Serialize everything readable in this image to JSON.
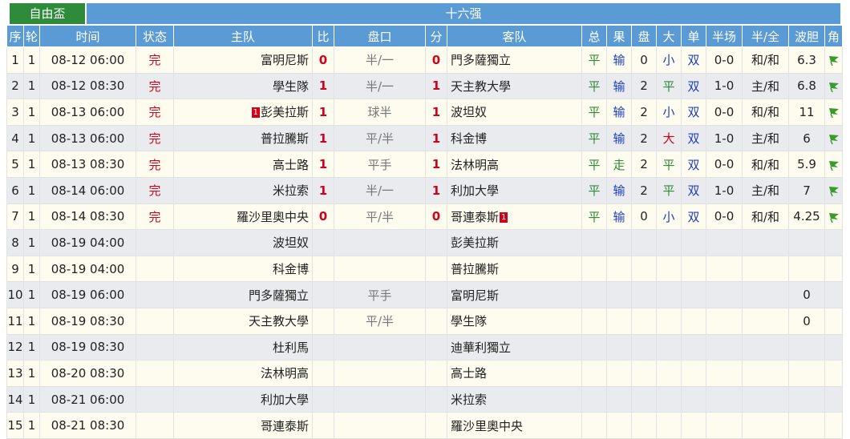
{
  "tabs": {
    "cup": "自由盃",
    "round": "十六强"
  },
  "headers": [
    "序",
    "轮",
    "时间",
    "状态",
    "主队",
    "比",
    "盘口",
    "分",
    "客队",
    "总",
    "果",
    "盘",
    "大",
    "单",
    "半场",
    "半/全",
    "波胆",
    "角"
  ],
  "rows": [
    {
      "no": "1",
      "rd": "1",
      "time": "08-12 06:00",
      "status": "完",
      "home": "富明尼斯",
      "hs": "0",
      "line": "半/一",
      "as": "0",
      "away": "門多薩獨立",
      "total": "平",
      "result": "输",
      "pan": "0",
      "size": "小",
      "oe": "双",
      "half": "0-0",
      "hf": "和/和",
      "odds": "6.3",
      "corner": "flag"
    },
    {
      "no": "2",
      "rd": "1",
      "time": "08-12 08:30",
      "status": "完",
      "home": "學生隊",
      "hs": "1",
      "line": "半/一",
      "as": "1",
      "away": "天主教大學",
      "total": "平",
      "result": "输",
      "pan": "2",
      "size": "平",
      "oe": "双",
      "half": "1-0",
      "hf": "主/和",
      "odds": "6.8",
      "corner": "flag"
    },
    {
      "no": "3",
      "rd": "1",
      "time": "08-13 06:00",
      "status": "完",
      "home": "彭美拉斯",
      "homecard": "1",
      "hs": "1",
      "line": "球半",
      "as": "1",
      "away": "波坦奴",
      "total": "平",
      "result": "输",
      "pan": "2",
      "size": "小",
      "oe": "双",
      "half": "0-0",
      "hf": "和/和",
      "odds": "11",
      "corner": "flag"
    },
    {
      "no": "4",
      "rd": "1",
      "time": "08-13 06:00",
      "status": "完",
      "home": "普拉騰斯",
      "hs": "1",
      "line": "平/半",
      "as": "1",
      "away": "科金博",
      "total": "平",
      "result": "输",
      "pan": "2",
      "size": "大",
      "oe": "双",
      "half": "1-0",
      "hf": "主/和",
      "odds": "6",
      "corner": "flag"
    },
    {
      "no": "5",
      "rd": "1",
      "time": "08-13 08:30",
      "status": "完",
      "home": "高士路",
      "hs": "1",
      "line": "平手",
      "as": "1",
      "away": "法林明高",
      "total": "平",
      "result": "走",
      "pan": "2",
      "size": "平",
      "oe": "双",
      "half": "0-0",
      "hf": "和/和",
      "odds": "5.9",
      "corner": "flag"
    },
    {
      "no": "6",
      "rd": "1",
      "time": "08-14 06:00",
      "status": "完",
      "home": "米拉索",
      "hs": "1",
      "line": "半/一",
      "as": "1",
      "away": "利加大學",
      "total": "平",
      "result": "输",
      "pan": "2",
      "size": "平",
      "oe": "双",
      "half": "1-0",
      "hf": "主/和",
      "odds": "7",
      "corner": "flag"
    },
    {
      "no": "7",
      "rd": "1",
      "time": "08-14 08:30",
      "status": "完",
      "home": "羅沙里奧中央",
      "hs": "0",
      "line": "平/半",
      "as": "0",
      "away": "哥連泰斯",
      "awaycard": "1",
      "total": "平",
      "result": "输",
      "pan": "0",
      "size": "小",
      "oe": "双",
      "half": "0-0",
      "hf": "和/和",
      "odds": "4.25",
      "corner": "flag"
    },
    {
      "no": "8",
      "rd": "1",
      "time": "08-19 04:00",
      "status": "",
      "home": "波坦奴",
      "hs": "",
      "line": "",
      "as": "",
      "away": "彭美拉斯",
      "total": "",
      "result": "",
      "pan": "",
      "size": "",
      "oe": "",
      "half": "",
      "hf": "",
      "odds": "",
      "corner": ""
    },
    {
      "no": "9",
      "rd": "1",
      "time": "08-19 04:00",
      "status": "",
      "home": "科金博",
      "hs": "",
      "line": "",
      "as": "",
      "away": "普拉騰斯",
      "total": "",
      "result": "",
      "pan": "",
      "size": "",
      "oe": "",
      "half": "",
      "hf": "",
      "odds": "",
      "corner": ""
    },
    {
      "no": "10",
      "rd": "1",
      "time": "08-19 06:00",
      "status": "",
      "home": "門多薩獨立",
      "hs": "",
      "line": "平手",
      "as": "",
      "away": "富明尼斯",
      "total": "",
      "result": "",
      "pan": "",
      "size": "",
      "oe": "",
      "half": "",
      "hf": "",
      "odds": "0",
      "corner": ""
    },
    {
      "no": "11",
      "rd": "1",
      "time": "08-19 08:30",
      "status": "",
      "home": "天主教大學",
      "hs": "",
      "line": "平/半",
      "as": "",
      "away": "學生隊",
      "total": "",
      "result": "",
      "pan": "",
      "size": "",
      "oe": "",
      "half": "",
      "hf": "",
      "odds": "0",
      "corner": ""
    },
    {
      "no": "12",
      "rd": "1",
      "time": "08-19 08:30",
      "status": "",
      "home": "杜利馬",
      "hs": "",
      "line": "",
      "as": "",
      "away": "迪華利獨立",
      "total": "",
      "result": "",
      "pan": "",
      "size": "",
      "oe": "",
      "half": "",
      "hf": "",
      "odds": "",
      "corner": ""
    },
    {
      "no": "13",
      "rd": "1",
      "time": "08-20 08:30",
      "status": "",
      "home": "法林明高",
      "hs": "",
      "line": "",
      "as": "",
      "away": "高士路",
      "total": "",
      "result": "",
      "pan": "",
      "size": "",
      "oe": "",
      "half": "",
      "hf": "",
      "odds": "",
      "corner": ""
    },
    {
      "no": "14",
      "rd": "1",
      "time": "08-21 06:00",
      "status": "",
      "home": "利加大學",
      "hs": "",
      "line": "",
      "as": "",
      "away": "米拉索",
      "total": "",
      "result": "",
      "pan": "",
      "size": "",
      "oe": "",
      "half": "",
      "hf": "",
      "odds": "",
      "corner": ""
    },
    {
      "no": "15",
      "rd": "1",
      "time": "08-21 08:30",
      "status": "",
      "home": "哥連泰斯",
      "hs": "",
      "line": "",
      "as": "",
      "away": "羅沙里奧中央",
      "total": "",
      "result": "",
      "pan": "",
      "size": "",
      "oe": "",
      "half": "",
      "hf": "",
      "odds": "",
      "corner": ""
    }
  ],
  "colors": {
    "header": "#5b9bd5",
    "cup_tab": "#2e8b3a",
    "score": "#d0021b",
    "flag": "#3a9a2e"
  }
}
